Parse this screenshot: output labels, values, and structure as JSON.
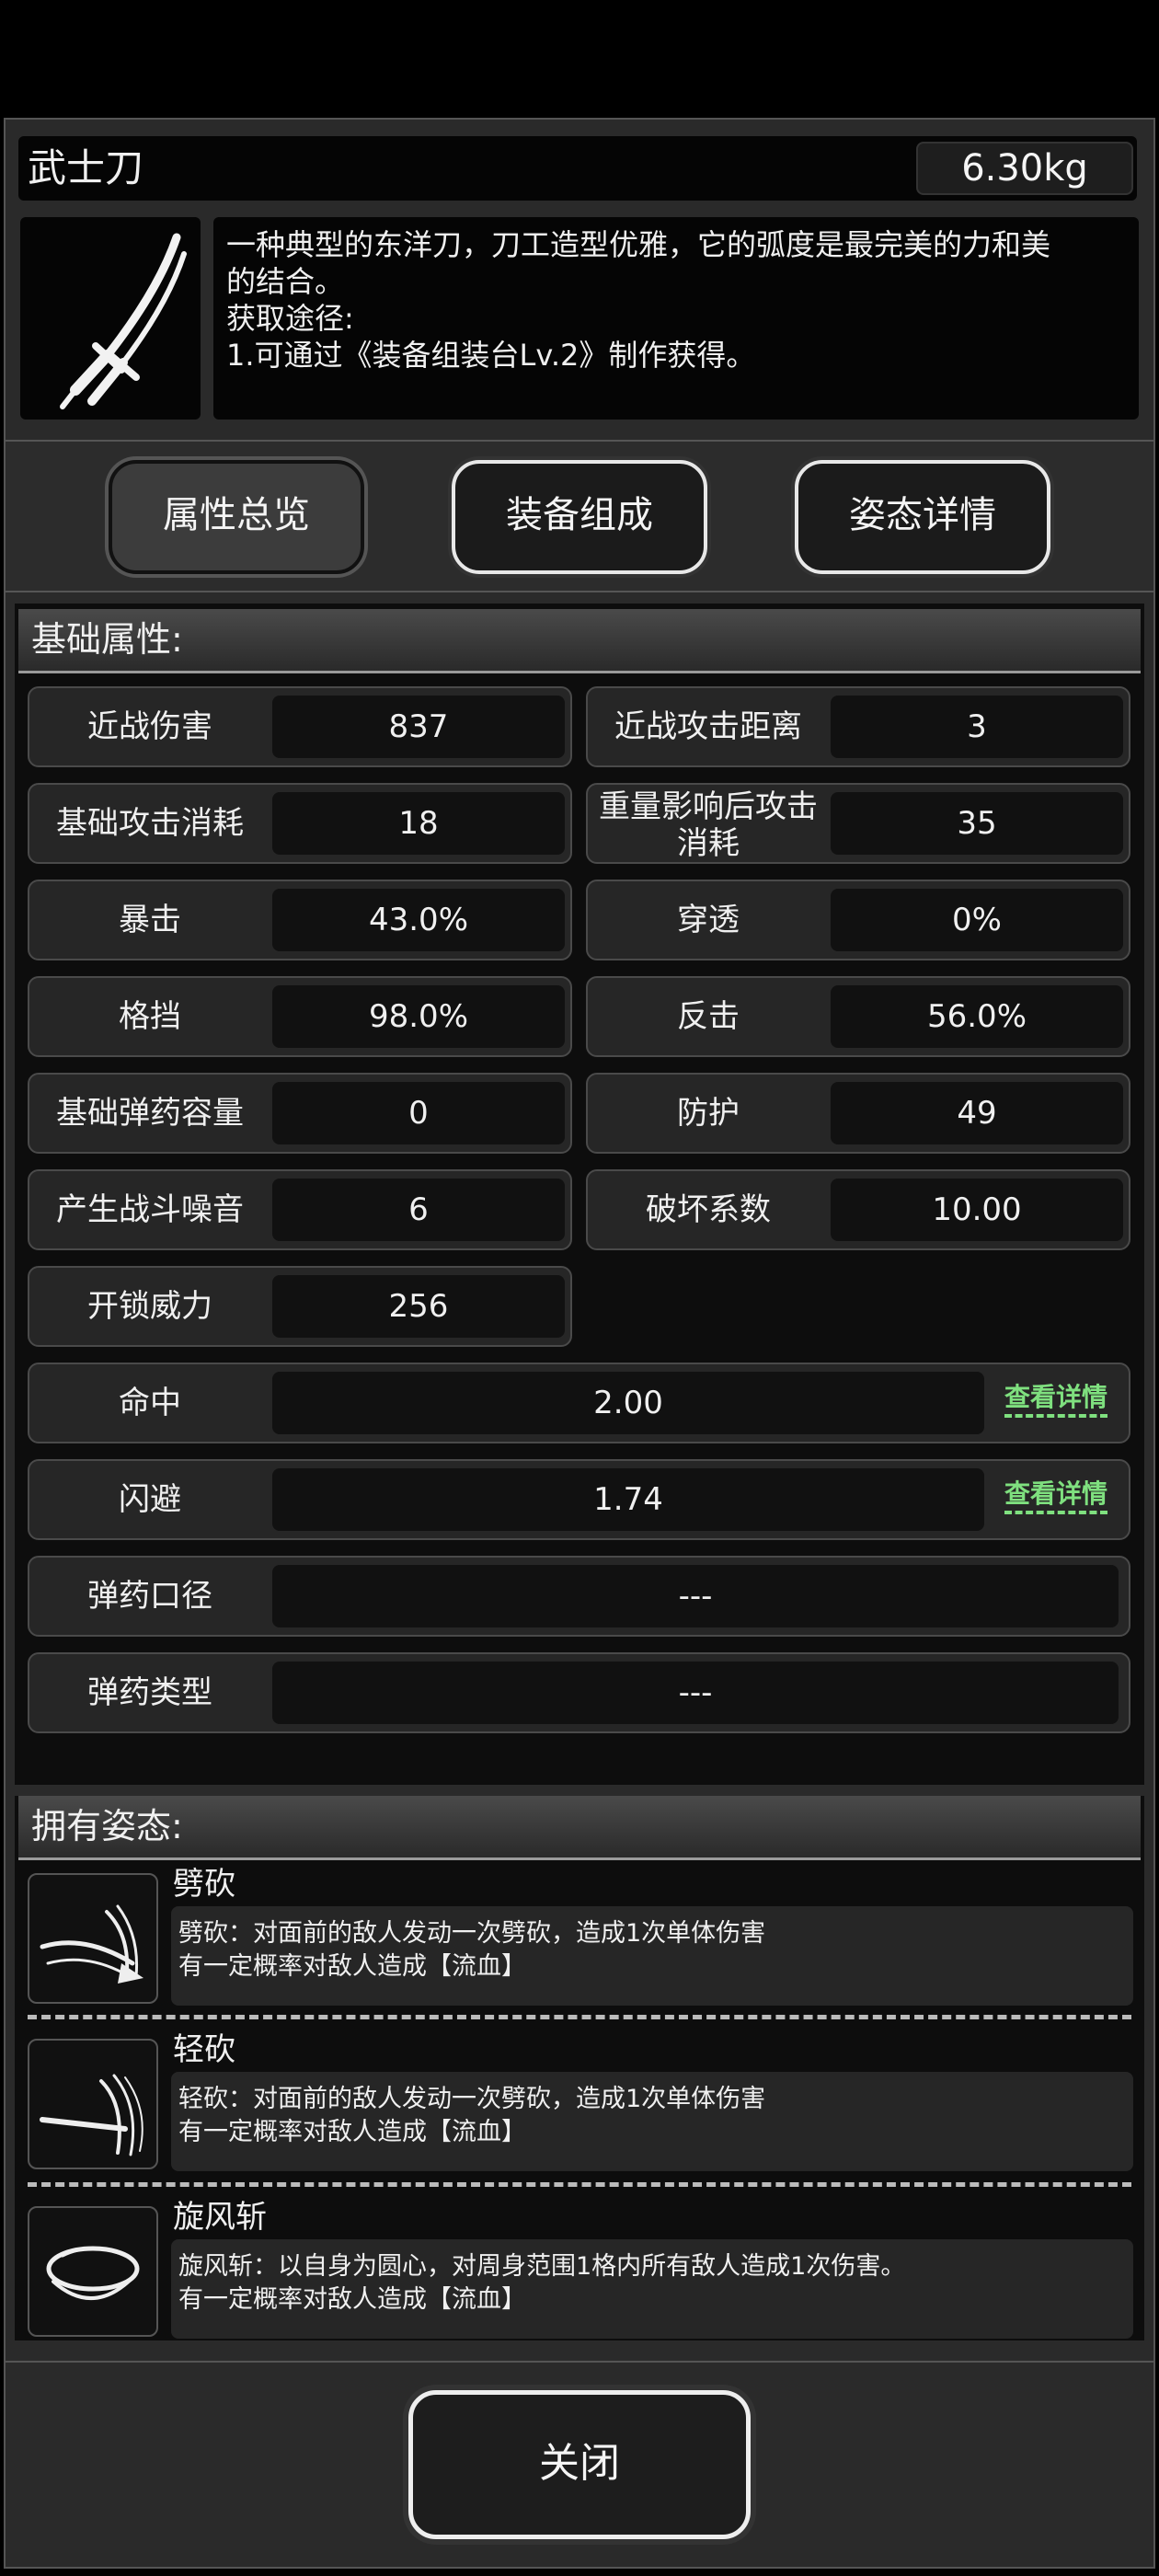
{
  "item": {
    "name": "武士刀",
    "weight": "6.30kg",
    "description": [
      "一种典型的东洋刀，刀工造型优雅，它的弧度是最完美的力和美",
      "的结合。",
      "获取途径:",
      "1.可通过《装备组装台Lv.2》制作获得。"
    ],
    "icon": "katana-icon"
  },
  "tabs": [
    {
      "label": "属性总览",
      "active": true
    },
    {
      "label": "装备组成",
      "active": false
    },
    {
      "label": "姿态详情",
      "active": false
    }
  ],
  "basic": {
    "header": "基础属性:",
    "pairs": [
      [
        {
          "label": "近战伤害",
          "value": "837"
        },
        {
          "label": "近战攻击距离",
          "value": "3"
        }
      ],
      [
        {
          "label": "基础攻击消耗",
          "value": "18"
        },
        {
          "label": "重量影响后攻击消耗",
          "value": "35"
        }
      ],
      [
        {
          "label": "暴击",
          "value": "43.0%"
        },
        {
          "label": "穿透",
          "value": "0%"
        }
      ],
      [
        {
          "label": "格挡",
          "value": "98.0%"
        },
        {
          "label": "反击",
          "value": "56.0%"
        }
      ],
      [
        {
          "label": "基础弹药容量",
          "value": "0"
        },
        {
          "label": "防护",
          "value": "49"
        }
      ],
      [
        {
          "label": "产生战斗噪音",
          "value": "6"
        },
        {
          "label": "破坏系数",
          "value": "10.00"
        }
      ],
      [
        {
          "label": "开锁威力",
          "value": "256"
        }
      ]
    ],
    "wide": [
      {
        "label": "命中",
        "value": "2.00",
        "link": "查看详情"
      },
      {
        "label": "闪避",
        "value": "1.74",
        "link": "查看详情"
      },
      {
        "label": "弹药口径",
        "value": "---"
      },
      {
        "label": "弹药类型",
        "value": "---"
      }
    ]
  },
  "poses": {
    "header": "拥有姿态:",
    "items": [
      {
        "name": "劈砍",
        "icon": "chop-slash-icon",
        "desc1": "劈砍：对面前的敌人发动一次劈砍，造成1次单体伤害",
        "desc2": "有一定概率对敌人造成【流血】"
      },
      {
        "name": "轻砍",
        "icon": "light-slash-icon",
        "desc1": "轻砍：对面前的敌人发动一次劈砍，造成1次单体伤害",
        "desc2": "有一定概率对敌人造成【流血】"
      },
      {
        "name": "旋风斩",
        "icon": "whirlwind-slash-icon",
        "desc1": "旋风斩：以自身为圆心，对周身范围1格内所有敌人造成1次伤害。",
        "desc2": "有一定概率对敌人造成【流血】"
      }
    ]
  },
  "footer": {
    "close": "关闭"
  }
}
